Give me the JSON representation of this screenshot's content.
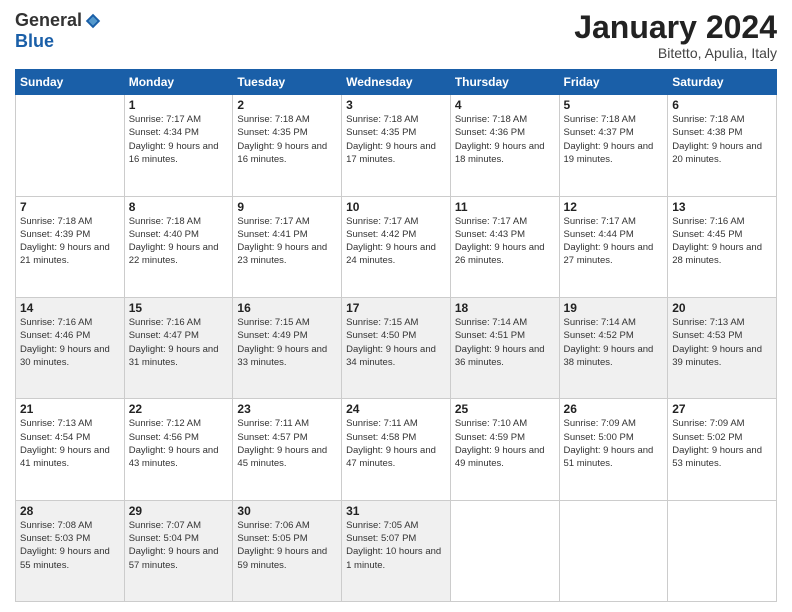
{
  "header": {
    "logo_general": "General",
    "logo_blue": "Blue",
    "month_title": "January 2024",
    "location": "Bitetto, Apulia, Italy"
  },
  "days_of_week": [
    "Sunday",
    "Monday",
    "Tuesday",
    "Wednesday",
    "Thursday",
    "Friday",
    "Saturday"
  ],
  "weeks": [
    [
      {
        "day": "",
        "sunrise": "",
        "sunset": "",
        "daylight": ""
      },
      {
        "day": "1",
        "sunrise": "Sunrise: 7:17 AM",
        "sunset": "Sunset: 4:34 PM",
        "daylight": "Daylight: 9 hours and 16 minutes."
      },
      {
        "day": "2",
        "sunrise": "Sunrise: 7:18 AM",
        "sunset": "Sunset: 4:35 PM",
        "daylight": "Daylight: 9 hours and 16 minutes."
      },
      {
        "day": "3",
        "sunrise": "Sunrise: 7:18 AM",
        "sunset": "Sunset: 4:35 PM",
        "daylight": "Daylight: 9 hours and 17 minutes."
      },
      {
        "day": "4",
        "sunrise": "Sunrise: 7:18 AM",
        "sunset": "Sunset: 4:36 PM",
        "daylight": "Daylight: 9 hours and 18 minutes."
      },
      {
        "day": "5",
        "sunrise": "Sunrise: 7:18 AM",
        "sunset": "Sunset: 4:37 PM",
        "daylight": "Daylight: 9 hours and 19 minutes."
      },
      {
        "day": "6",
        "sunrise": "Sunrise: 7:18 AM",
        "sunset": "Sunset: 4:38 PM",
        "daylight": "Daylight: 9 hours and 20 minutes."
      }
    ],
    [
      {
        "day": "7",
        "sunrise": "Sunrise: 7:18 AM",
        "sunset": "Sunset: 4:39 PM",
        "daylight": "Daylight: 9 hours and 21 minutes."
      },
      {
        "day": "8",
        "sunrise": "Sunrise: 7:18 AM",
        "sunset": "Sunset: 4:40 PM",
        "daylight": "Daylight: 9 hours and 22 minutes."
      },
      {
        "day": "9",
        "sunrise": "Sunrise: 7:17 AM",
        "sunset": "Sunset: 4:41 PM",
        "daylight": "Daylight: 9 hours and 23 minutes."
      },
      {
        "day": "10",
        "sunrise": "Sunrise: 7:17 AM",
        "sunset": "Sunset: 4:42 PM",
        "daylight": "Daylight: 9 hours and 24 minutes."
      },
      {
        "day": "11",
        "sunrise": "Sunrise: 7:17 AM",
        "sunset": "Sunset: 4:43 PM",
        "daylight": "Daylight: 9 hours and 26 minutes."
      },
      {
        "day": "12",
        "sunrise": "Sunrise: 7:17 AM",
        "sunset": "Sunset: 4:44 PM",
        "daylight": "Daylight: 9 hours and 27 minutes."
      },
      {
        "day": "13",
        "sunrise": "Sunrise: 7:16 AM",
        "sunset": "Sunset: 4:45 PM",
        "daylight": "Daylight: 9 hours and 28 minutes."
      }
    ],
    [
      {
        "day": "14",
        "sunrise": "Sunrise: 7:16 AM",
        "sunset": "Sunset: 4:46 PM",
        "daylight": "Daylight: 9 hours and 30 minutes."
      },
      {
        "day": "15",
        "sunrise": "Sunrise: 7:16 AM",
        "sunset": "Sunset: 4:47 PM",
        "daylight": "Daylight: 9 hours and 31 minutes."
      },
      {
        "day": "16",
        "sunrise": "Sunrise: 7:15 AM",
        "sunset": "Sunset: 4:49 PM",
        "daylight": "Daylight: 9 hours and 33 minutes."
      },
      {
        "day": "17",
        "sunrise": "Sunrise: 7:15 AM",
        "sunset": "Sunset: 4:50 PM",
        "daylight": "Daylight: 9 hours and 34 minutes."
      },
      {
        "day": "18",
        "sunrise": "Sunrise: 7:14 AM",
        "sunset": "Sunset: 4:51 PM",
        "daylight": "Daylight: 9 hours and 36 minutes."
      },
      {
        "day": "19",
        "sunrise": "Sunrise: 7:14 AM",
        "sunset": "Sunset: 4:52 PM",
        "daylight": "Daylight: 9 hours and 38 minutes."
      },
      {
        "day": "20",
        "sunrise": "Sunrise: 7:13 AM",
        "sunset": "Sunset: 4:53 PM",
        "daylight": "Daylight: 9 hours and 39 minutes."
      }
    ],
    [
      {
        "day": "21",
        "sunrise": "Sunrise: 7:13 AM",
        "sunset": "Sunset: 4:54 PM",
        "daylight": "Daylight: 9 hours and 41 minutes."
      },
      {
        "day": "22",
        "sunrise": "Sunrise: 7:12 AM",
        "sunset": "Sunset: 4:56 PM",
        "daylight": "Daylight: 9 hours and 43 minutes."
      },
      {
        "day": "23",
        "sunrise": "Sunrise: 7:11 AM",
        "sunset": "Sunset: 4:57 PM",
        "daylight": "Daylight: 9 hours and 45 minutes."
      },
      {
        "day": "24",
        "sunrise": "Sunrise: 7:11 AM",
        "sunset": "Sunset: 4:58 PM",
        "daylight": "Daylight: 9 hours and 47 minutes."
      },
      {
        "day": "25",
        "sunrise": "Sunrise: 7:10 AM",
        "sunset": "Sunset: 4:59 PM",
        "daylight": "Daylight: 9 hours and 49 minutes."
      },
      {
        "day": "26",
        "sunrise": "Sunrise: 7:09 AM",
        "sunset": "Sunset: 5:00 PM",
        "daylight": "Daylight: 9 hours and 51 minutes."
      },
      {
        "day": "27",
        "sunrise": "Sunrise: 7:09 AM",
        "sunset": "Sunset: 5:02 PM",
        "daylight": "Daylight: 9 hours and 53 minutes."
      }
    ],
    [
      {
        "day": "28",
        "sunrise": "Sunrise: 7:08 AM",
        "sunset": "Sunset: 5:03 PM",
        "daylight": "Daylight: 9 hours and 55 minutes."
      },
      {
        "day": "29",
        "sunrise": "Sunrise: 7:07 AM",
        "sunset": "Sunset: 5:04 PM",
        "daylight": "Daylight: 9 hours and 57 minutes."
      },
      {
        "day": "30",
        "sunrise": "Sunrise: 7:06 AM",
        "sunset": "Sunset: 5:05 PM",
        "daylight": "Daylight: 9 hours and 59 minutes."
      },
      {
        "day": "31",
        "sunrise": "Sunrise: 7:05 AM",
        "sunset": "Sunset: 5:07 PM",
        "daylight": "Daylight: 10 hours and 1 minute."
      },
      {
        "day": "",
        "sunrise": "",
        "sunset": "",
        "daylight": ""
      },
      {
        "day": "",
        "sunrise": "",
        "sunset": "",
        "daylight": ""
      },
      {
        "day": "",
        "sunrise": "",
        "sunset": "",
        "daylight": ""
      }
    ]
  ]
}
